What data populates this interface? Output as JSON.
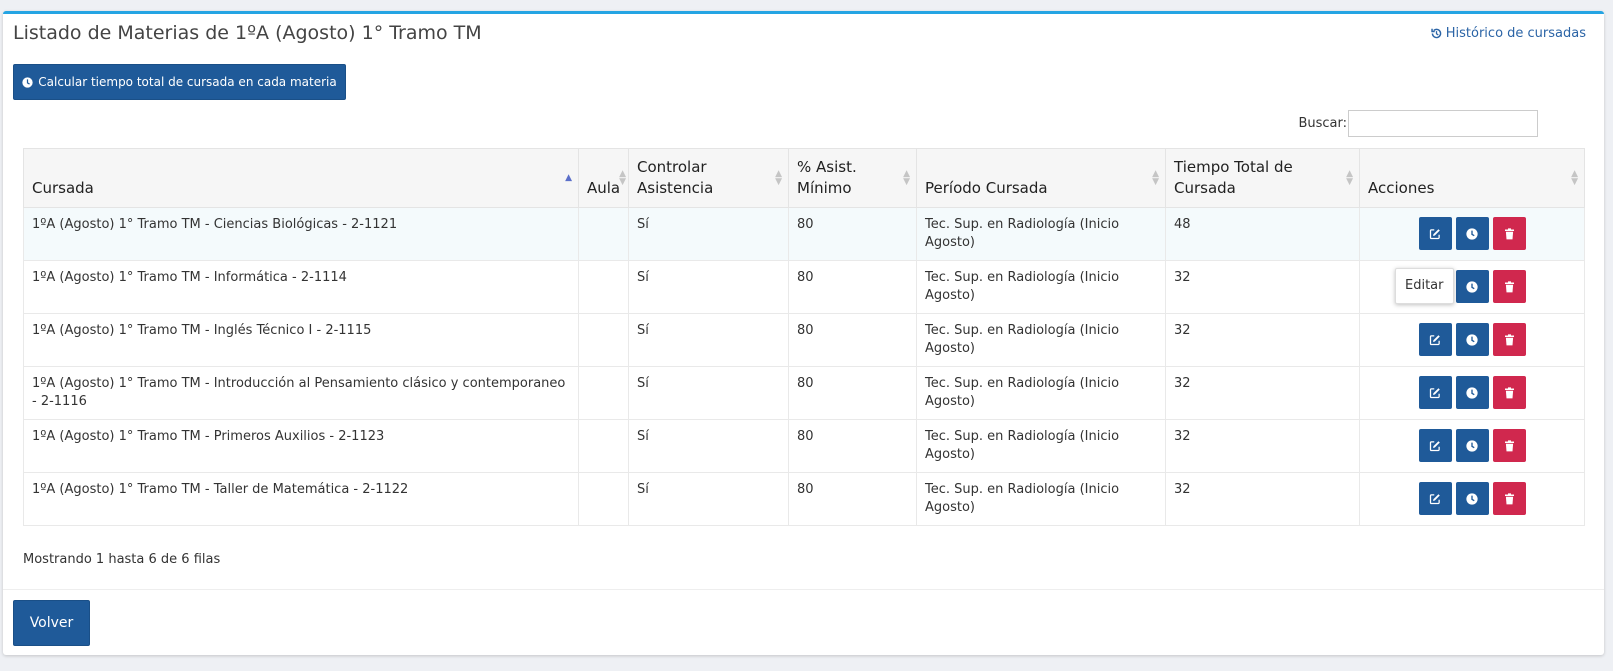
{
  "header": {
    "title": "Listado de Materias de 1ºA (Agosto) 1° Tramo TM",
    "historico_link": "Histórico de cursadas"
  },
  "toolbar": {
    "calc_label": "Calcular tiempo total de cursada en cada materia"
  },
  "search": {
    "label": "Buscar:",
    "value": ""
  },
  "table": {
    "columns": [
      "Cursada",
      "Aula",
      "Controlar Asistencia",
      "% Asist. Mínimo",
      "Período Cursada",
      "Tiempo Total de Cursada",
      "Acciones"
    ],
    "rows": [
      {
        "cursada": "1ºA (Agosto) 1° Tramo TM - Ciencias Biológicas - 2-1121",
        "aula": "",
        "controlar": "Sí",
        "asist": "80",
        "periodo": "Tec. Sup. en Radiología (Inicio Agosto)",
        "tiempo": "48"
      },
      {
        "cursada": "1ºA (Agosto) 1° Tramo TM - Informática - 2-1114",
        "aula": "",
        "controlar": "Sí",
        "asist": "80",
        "periodo": "Tec. Sup. en Radiología (Inicio Agosto)",
        "tiempo": "32"
      },
      {
        "cursada": "1ºA (Agosto) 1° Tramo TM - Inglés Técnico I - 2-1115",
        "aula": "",
        "controlar": "Sí",
        "asist": "80",
        "periodo": "Tec. Sup. en Radiología (Inicio Agosto)",
        "tiempo": "32"
      },
      {
        "cursada": "1ºA (Agosto) 1° Tramo TM - Introducción al Pensamiento clásico y contemporaneo - 2-1116",
        "aula": "",
        "controlar": "Sí",
        "asist": "80",
        "periodo": "Tec. Sup. en Radiología (Inicio Agosto)",
        "tiempo": "32"
      },
      {
        "cursada": "1ºA (Agosto) 1° Tramo TM - Primeros Auxilios - 2-1123",
        "aula": "",
        "controlar": "Sí",
        "asist": "80",
        "periodo": "Tec. Sup. en Radiología (Inicio Agosto)",
        "tiempo": "32"
      },
      {
        "cursada": "1ºA (Agosto) 1° Tramo TM - Taller de Matemática - 2-1122",
        "aula": "",
        "controlar": "Sí",
        "asist": "80",
        "periodo": "Tec. Sup. en Radiología (Inicio Agosto)",
        "tiempo": "32"
      }
    ],
    "tooltip": "Editar",
    "row_icons": [
      "edit-icon",
      "clock-icon",
      "trash-icon"
    ]
  },
  "footer": {
    "info": "Mostrando 1 hasta 6 de 6 filas",
    "back_label": "Volver"
  },
  "colors": {
    "primary": "#1f5a99",
    "danger": "#d0284e",
    "accent_border": "#24a4e3",
    "link": "#2b64a6"
  }
}
